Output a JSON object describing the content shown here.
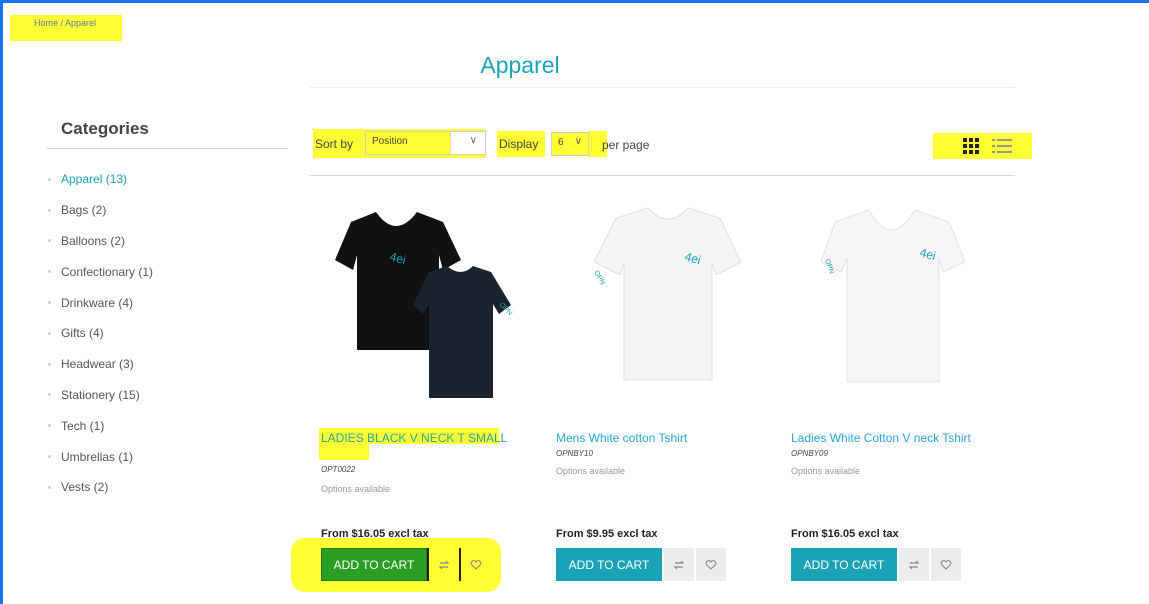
{
  "breadcrumb": "Home / Apparel",
  "page_title": "Apparel",
  "categories": {
    "title": "Categories",
    "items": [
      {
        "label": "Apparel (13)",
        "active": true
      },
      {
        "label": "Bags (2)"
      },
      {
        "label": "Balloons (2)"
      },
      {
        "label": "Confectionary (1)"
      },
      {
        "label": "Drinkware (4)"
      },
      {
        "label": "Gifts (4)"
      },
      {
        "label": "Headwear (3)"
      },
      {
        "label": "Stationery (15)"
      },
      {
        "label": "Tech (1)"
      },
      {
        "label": "Umbrellas (1)"
      },
      {
        "label": "Vests (2)"
      }
    ]
  },
  "toolbar": {
    "sort_label": "Sort by",
    "sort_value": "Position",
    "display_label": "Display",
    "display_value": "6",
    "per_page": "per page"
  },
  "products": [
    {
      "name": "LADIES BLACK V NECK T SMALL",
      "sku": "OPT0022",
      "options": "Options available",
      "price": "From $16.05 excl tax",
      "add_label": "ADD TO CART"
    },
    {
      "name": "Mens White cotton Tshirt",
      "sku": "OPNBY10",
      "options": "Options available",
      "price": "From $9.95 excl tax",
      "add_label": "ADD TO CART"
    },
    {
      "name": "Ladies White Cotton V neck Tshirt",
      "sku": "OPNBY09",
      "options": "Options available",
      "price": "From $16.05 excl tax",
      "add_label": "ADD TO CART"
    }
  ],
  "colors": {
    "accent": "#1aa3b7",
    "link": "#29a5d6",
    "highlight": "#ffff33",
    "frame": "#1a73e8"
  }
}
